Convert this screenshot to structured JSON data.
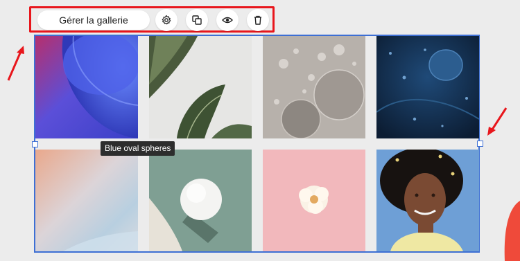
{
  "toolbar": {
    "manage_label": "Gérer la gallerie",
    "icons": [
      "settings-icon",
      "duplicate-icon",
      "preview-icon",
      "delete-icon"
    ]
  },
  "gallery": {
    "images": [
      {
        "name": "blue-abstract-curves"
      },
      {
        "name": "green-banana-leaves"
      },
      {
        "name": "gray-oil-bubbles"
      },
      {
        "name": "blue-oval-spheres"
      },
      {
        "name": "pastel-gradient"
      },
      {
        "name": "white-sphere-shadow"
      },
      {
        "name": "flower-on-pink"
      },
      {
        "name": "smiling-woman"
      }
    ]
  },
  "tooltip": {
    "text": "Blue oval spheres"
  },
  "colors": {
    "selection": "#3d6fd4",
    "highlight": "#e8161c"
  }
}
